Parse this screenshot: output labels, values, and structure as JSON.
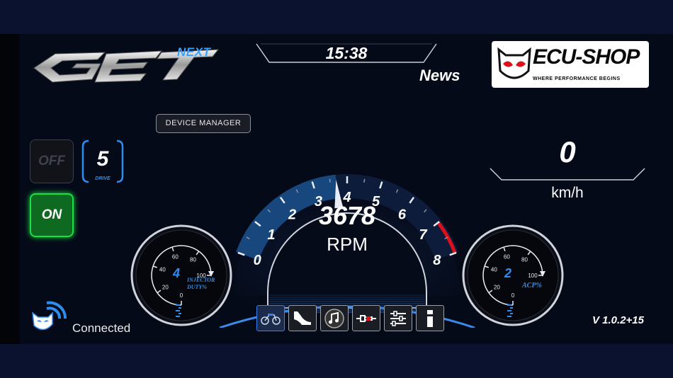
{
  "header": {
    "logo_brand": "GET",
    "logo_suffix": "NEXT",
    "clock": "15:38",
    "news_label": "News",
    "partner_logo_text": "ECU-SHOP",
    "partner_logo_tagline": "WHERE PERFORMANCE BEGINS"
  },
  "controls": {
    "device_manager_label": "DEVICE MANAGER",
    "off_label": "OFF",
    "on_label": "ON",
    "drive_mode_value": "5",
    "drive_mode_label": "DRIVE"
  },
  "rpm_gauge": {
    "value": "3678",
    "unit": "RPM",
    "ticks": [
      "0",
      "1",
      "2",
      "3",
      "4",
      "5",
      "6",
      "7",
      "8"
    ],
    "needle_value": 3.68,
    "max": 8,
    "redline_start": 7
  },
  "injector_gauge": {
    "value": "4",
    "label": "INJECTOR DUTY%",
    "ticks": [
      "0",
      "20",
      "40",
      "60",
      "80",
      "100"
    ],
    "level": 4
  },
  "acp_gauge": {
    "value": "2",
    "label": "ACP%",
    "ticks": [
      "0",
      "20",
      "40",
      "60",
      "80",
      "100"
    ],
    "level": 2
  },
  "speed": {
    "value": "0",
    "unit": "km/h"
  },
  "nav": {
    "items": [
      "dashboard-icon",
      "chart-icon",
      "music-icon",
      "injector-icon",
      "settings-sliders-icon",
      "info-icon"
    ],
    "active_index": 0
  },
  "status": {
    "connection": "Connected",
    "version": "V 1.0.2+15"
  },
  "colors": {
    "accent_blue": "#2e8ef0",
    "on_green": "#19e042",
    "redline": "#e0101a"
  }
}
